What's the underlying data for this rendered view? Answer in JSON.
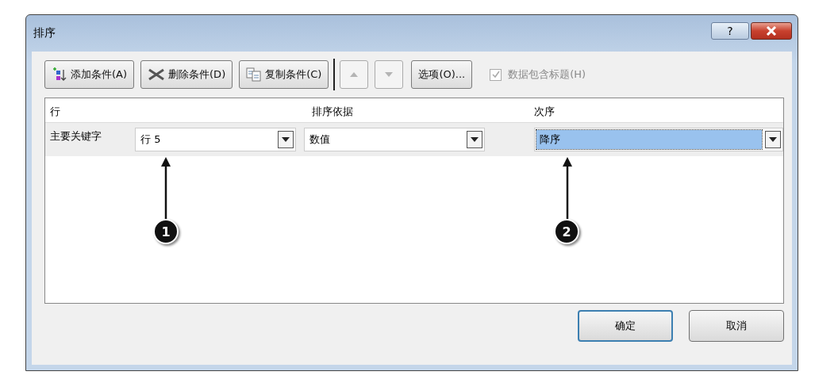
{
  "window": {
    "title": "排序",
    "help": "?"
  },
  "toolbar": [
    {
      "kind": "add",
      "label": "添加条件(A)"
    },
    {
      "kind": "delete",
      "label": "删除条件(D)"
    },
    {
      "kind": "copy",
      "label": "复制条件(C)"
    },
    {
      "kind": "up",
      "disabled": true
    },
    {
      "kind": "down",
      "disabled": true
    },
    {
      "kind": "options",
      "label": "选项(O)..."
    }
  ],
  "header_checkbox": {
    "label": "数据包含标题(H)",
    "checked": true,
    "disabled": true
  },
  "columns": [
    "行",
    "排序依据",
    "次序"
  ],
  "rows": [
    {
      "label": "主要关键字",
      "cells": [
        {
          "value": "行 5",
          "selected": false
        },
        {
          "value": "数值",
          "selected": false
        },
        {
          "value": "降序",
          "selected": true
        }
      ]
    }
  ],
  "callouts": [
    {
      "number": "1"
    },
    {
      "number": "2"
    }
  ],
  "buttons": [
    {
      "label": "确定",
      "default": true
    },
    {
      "label": "取消",
      "default": false
    }
  ]
}
